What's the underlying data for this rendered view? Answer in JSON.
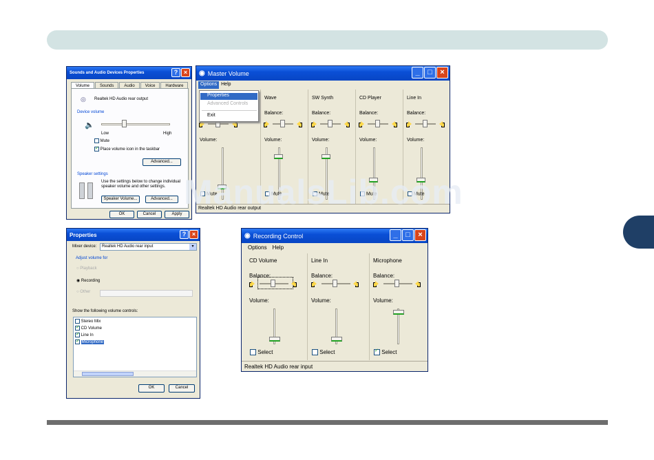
{
  "sound_props": {
    "title": "Sounds and Audio Devices Properties",
    "tabs": [
      "Volume",
      "Sounds",
      "Audio",
      "Voice",
      "Hardware"
    ],
    "device": "Realtek HD Audio rear output",
    "device_volume_label": "Device volume",
    "low": "Low",
    "high": "High",
    "mute": "Mute",
    "place_icon": "Place volume icon in the taskbar",
    "advanced": "Advanced...",
    "speaker_settings": "Speaker settings",
    "speaker_text": "Use the settings below to change individual speaker volume and other settings.",
    "speaker_volume": "Speaker Volume...",
    "advanced2": "Advanced...",
    "ok": "OK",
    "cancel": "Cancel",
    "apply": "Apply"
  },
  "master": {
    "title": "Master Volume",
    "menu": [
      "Options",
      "Help"
    ],
    "dropdown": [
      "Properties",
      "Advanced Controls",
      "Exit"
    ],
    "columns": [
      {
        "name": "",
        "slider": 0.2
      },
      {
        "name": "Wave",
        "slider": 0.85
      },
      {
        "name": "SW Synth",
        "slider": 0.85
      },
      {
        "name": "CD Player",
        "slider": 0.35
      },
      {
        "name": "Line In",
        "slider": 0.35
      }
    ],
    "balance": "Balance:",
    "volume": "Volume:",
    "mute": "Mute",
    "status": "Realtek HD Audio rear output"
  },
  "props": {
    "title": "Properties",
    "mixer_label": "Mixer device:",
    "mixer_value": "Realtek HD Audio rear input",
    "adjust": "Adjust volume for",
    "playback": "Playback",
    "recording": "Recording",
    "other": "Other",
    "show": "Show the following volume controls:",
    "items": [
      {
        "label": "Stereo Mix",
        "checked": false
      },
      {
        "label": "CD Volume",
        "checked": true
      },
      {
        "label": "Line In",
        "checked": true
      },
      {
        "label": "Microphone",
        "checked": true
      }
    ],
    "ok": "OK",
    "cancel": "Cancel"
  },
  "recording": {
    "title": "Recording Control",
    "menu": [
      "Options",
      "Help"
    ],
    "columns": [
      {
        "name": "CD Volume",
        "slider": 0.1,
        "select": false
      },
      {
        "name": "Line In",
        "slider": 0.1,
        "select": false
      },
      {
        "name": "Microphone",
        "slider": 0.95,
        "select": true
      }
    ],
    "balance": "Balance:",
    "volume": "Volume:",
    "select": "Select",
    "status": "Realtek HD Audio rear input"
  },
  "watermark": "ManualsLib.com",
  "colors": {
    "titlebar": "#0a4fd6",
    "accent": "#1f3f66",
    "header_bar": "#d3e3e3"
  }
}
